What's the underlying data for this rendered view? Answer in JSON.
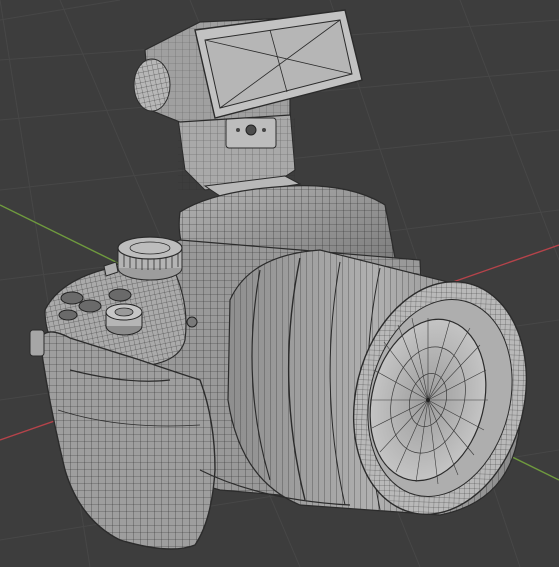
{
  "viewport": {
    "background": "#3d3d3d",
    "grid_color": "#4a4a4a",
    "axis_x_color": "#b5434a",
    "axis_y_color": "#6f9a3e",
    "mesh_fill": "#9a9a9a",
    "wire_color": "#2b2b2b",
    "overlay": "wireframe",
    "object": "camera-mesh"
  }
}
